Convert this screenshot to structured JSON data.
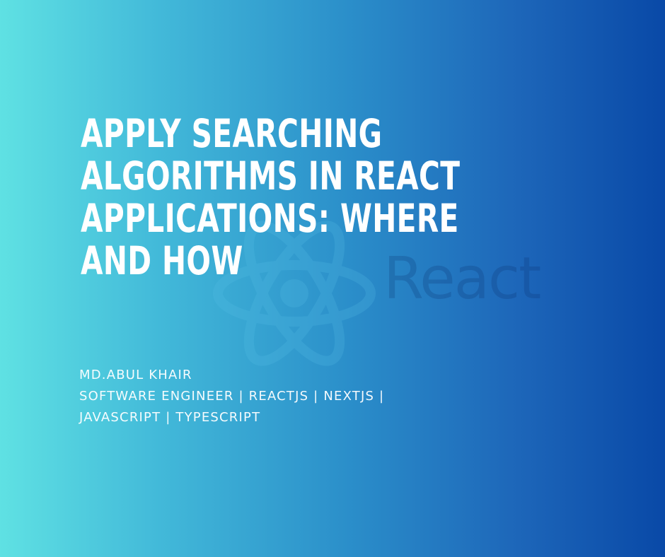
{
  "banner": {
    "title_lines": [
      "APPLY SEARCHING",
      "ALGORITHMS IN REACT",
      "APPLICATIONS: WHERE",
      "AND HOW"
    ],
    "author": "MD.ABUL KHAIR",
    "role_lines": [
      "SOFTWARE ENGINEER | REACTJS | NEXTJS |",
      "JAVASCRIPT | TYPESCRIPT"
    ],
    "logo_text": "React"
  },
  "colors": {
    "gradient_start": "#5fe1e3",
    "gradient_mid": "#2b8fca",
    "gradient_end": "#0949a7",
    "title_text": "#ffffff",
    "logo_atom": "#59c1e8",
    "logo_wordmark": "#0a2f6c"
  },
  "icons": {
    "logo_icon": "react-atom-icon"
  }
}
